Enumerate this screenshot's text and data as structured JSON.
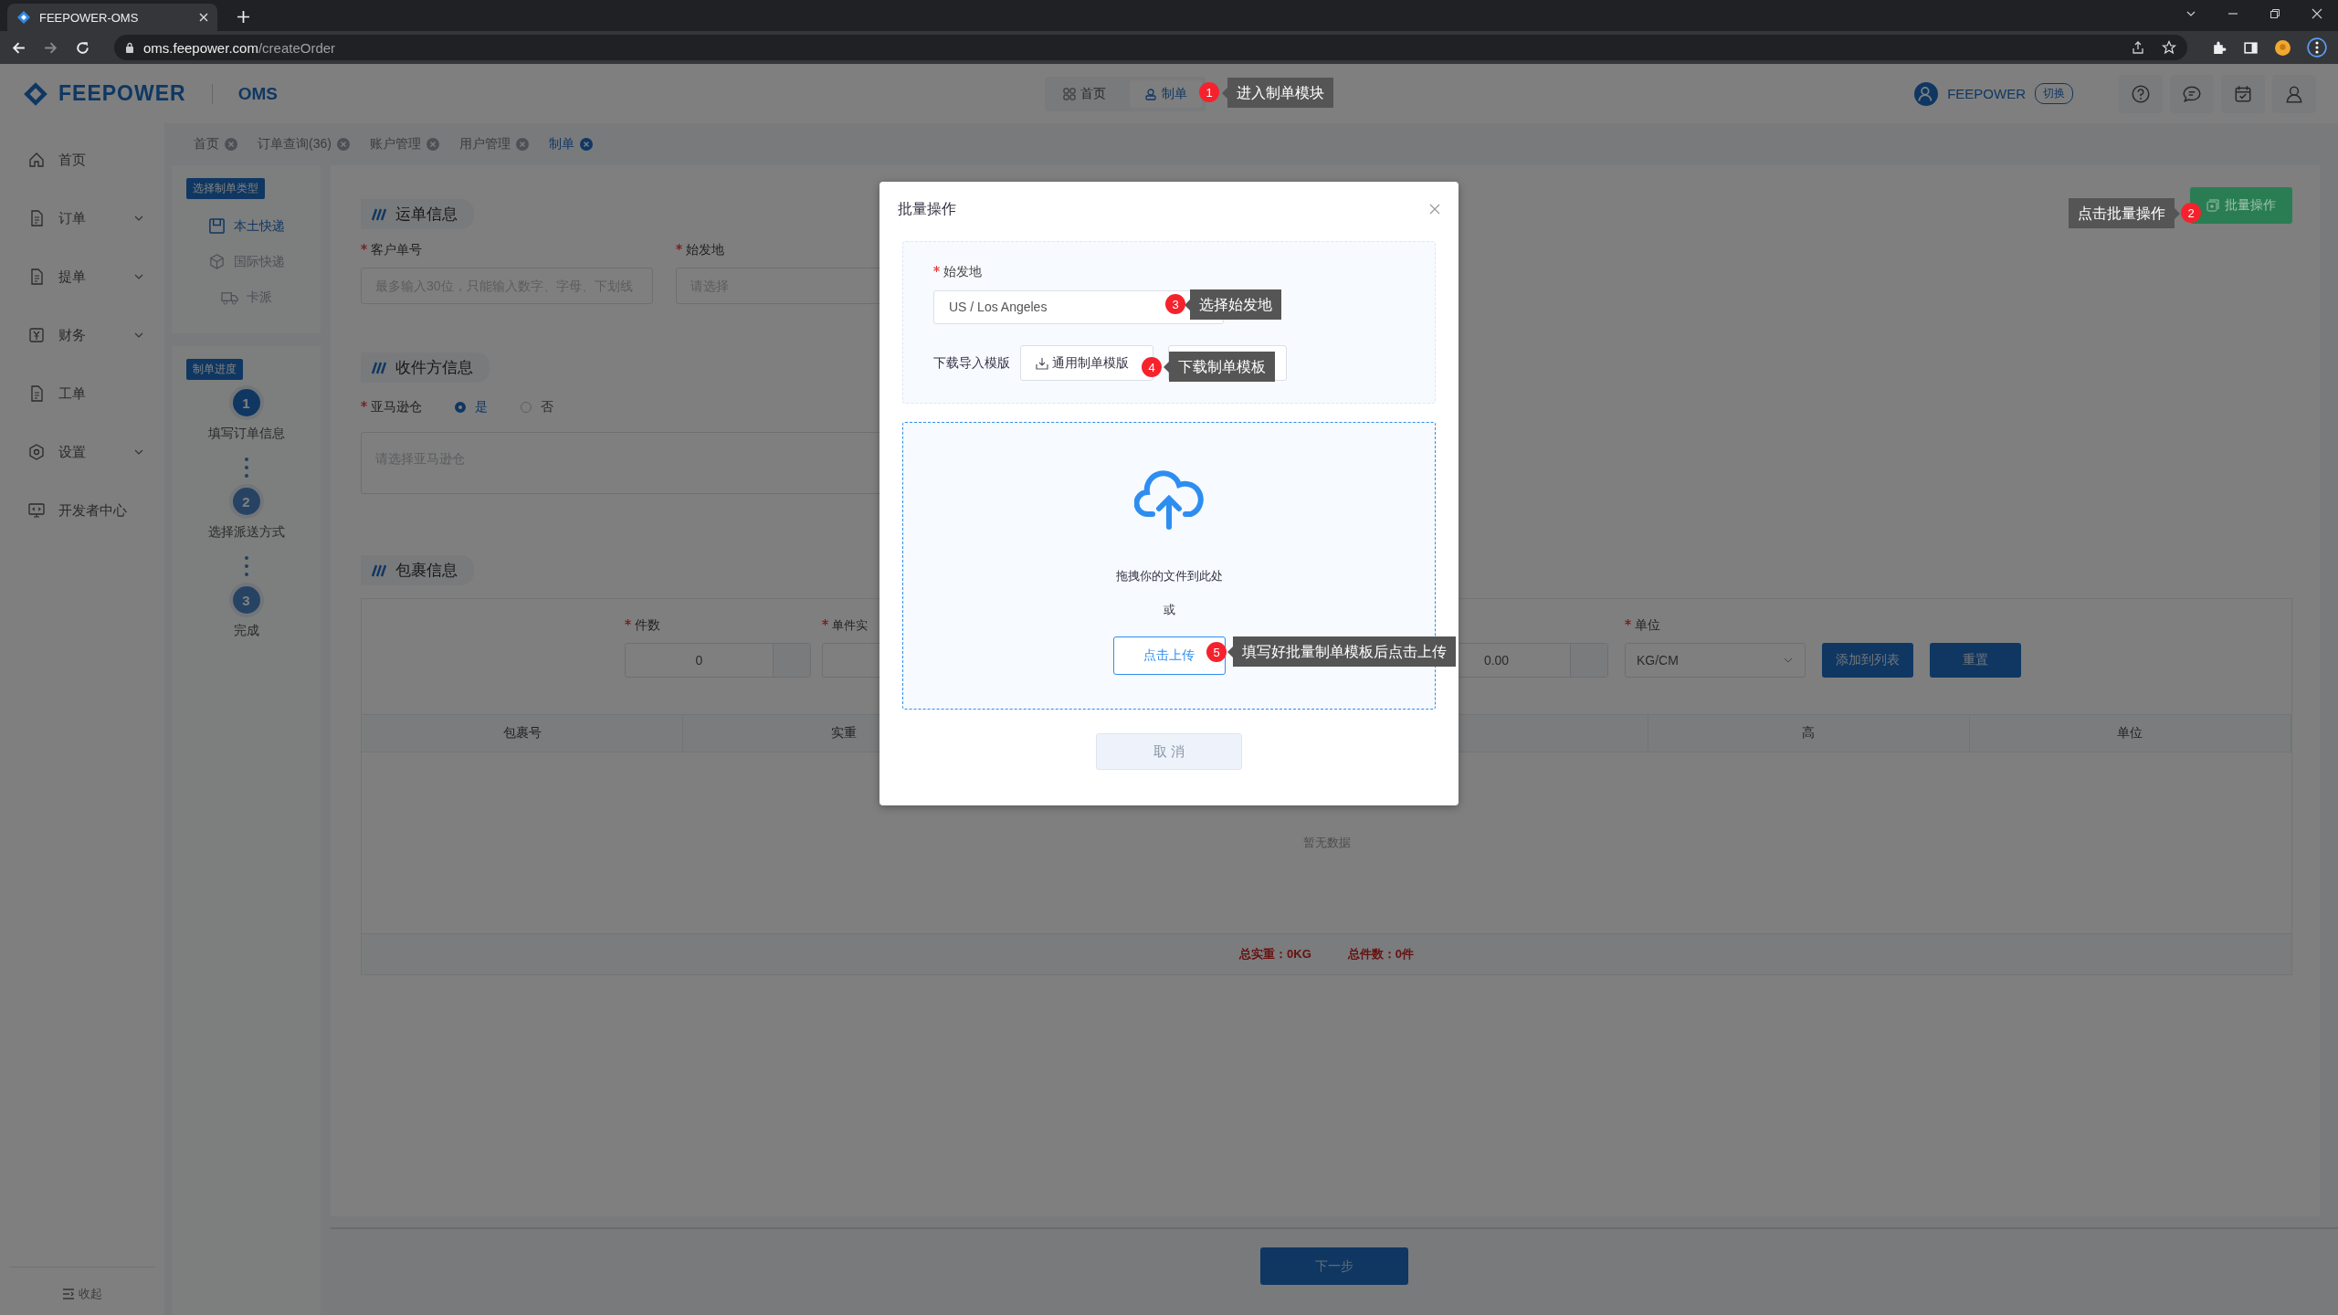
{
  "browser": {
    "tab_title": "FEEPOWER-OMS",
    "url_host": "oms.feepower.com",
    "url_path": "/createOrder"
  },
  "header": {
    "brand": "FEEPOWER",
    "product": "OMS",
    "nav": [
      {
        "label": "首页",
        "selected": false
      },
      {
        "label": "制单",
        "selected": true
      }
    ],
    "user": "FEEPOWER",
    "switch_label": "切换"
  },
  "sidebar": {
    "items": [
      {
        "label": "首页",
        "expandable": false
      },
      {
        "label": "订单",
        "expandable": true
      },
      {
        "label": "提单",
        "expandable": true
      },
      {
        "label": "财务",
        "expandable": true
      },
      {
        "label": "工单",
        "expandable": false
      },
      {
        "label": "设置",
        "expandable": true
      },
      {
        "label": "开发者中心",
        "expandable": false
      }
    ],
    "collapse_label": "收起"
  },
  "tabs": [
    {
      "label": "首页",
      "selected": false
    },
    {
      "label": "订单查询(36)",
      "selected": false
    },
    {
      "label": "账户管理",
      "selected": false
    },
    {
      "label": "用户管理",
      "selected": false
    },
    {
      "label": "制单",
      "selected": true
    }
  ],
  "order_type": {
    "title": "选择制单类型",
    "items": [
      {
        "label": "本土快递",
        "selected": true
      },
      {
        "label": "国际快递",
        "selected": false
      },
      {
        "label": "卡派",
        "selected": false
      }
    ]
  },
  "progress": {
    "title": "制单进度",
    "steps": [
      {
        "number": "1",
        "label": "填写订单信息",
        "selected": true
      },
      {
        "number": "2",
        "label": "选择派送方式",
        "selected": false
      },
      {
        "number": "3",
        "label": "完成",
        "selected": false
      }
    ]
  },
  "waybill": {
    "title": "运单信息",
    "fields": [
      {
        "label": "客户单号",
        "required": true,
        "placeholder": "最多输入30位，只能输入数字、字母、下划线"
      },
      {
        "label": "始发地",
        "required": true,
        "placeholder": "请选择"
      }
    ]
  },
  "receiver": {
    "title": "收件方信息",
    "label": "亚马逊仓",
    "required": true,
    "options": [
      {
        "label": "是",
        "selected": true
      },
      {
        "label": "否",
        "selected": false
      }
    ],
    "placeholder": "请选择亚马逊仓"
  },
  "package": {
    "title": "包裹信息",
    "count_required": true,
    "weight_required": true,
    "unit_required": true,
    "count_label": "件数",
    "count_value": "0",
    "weight_label": "单件实",
    "dimension_value": "0.00",
    "unit_label": "单位",
    "unit_value": "KG/CM",
    "add_button": "添加到列表",
    "reset_button": "重置",
    "left_columns": [
      "包裹号",
      "实重"
    ],
    "right_columns": [
      "高",
      "单位"
    ],
    "empty_text": "暂无数据",
    "total_weight": "总实重：0KG",
    "total_count": "总件数：0件"
  },
  "batch_button": "批量操作",
  "next_button": "下一步",
  "modal": {
    "title": "批量操作",
    "origin_required": true,
    "origin_label": "始发地",
    "origin_value": "US / Los Angeles",
    "download_label": "下载导入模版",
    "template_button": "通用制单模版",
    "drop_text": "拖拽你的文件到此处",
    "or_text": "或",
    "upload_button": "点击上传",
    "cancel_button": "取 消"
  },
  "guides": [
    {
      "number": "1",
      "text": "进入制单模块"
    },
    {
      "number": "2",
      "text": "点击批量操作"
    },
    {
      "number": "3",
      "text": "选择始发地"
    },
    {
      "number": "4",
      "text": "下载制单模板"
    },
    {
      "number": "5",
      "text": "填写好批量制单模板后点击上传"
    }
  ]
}
